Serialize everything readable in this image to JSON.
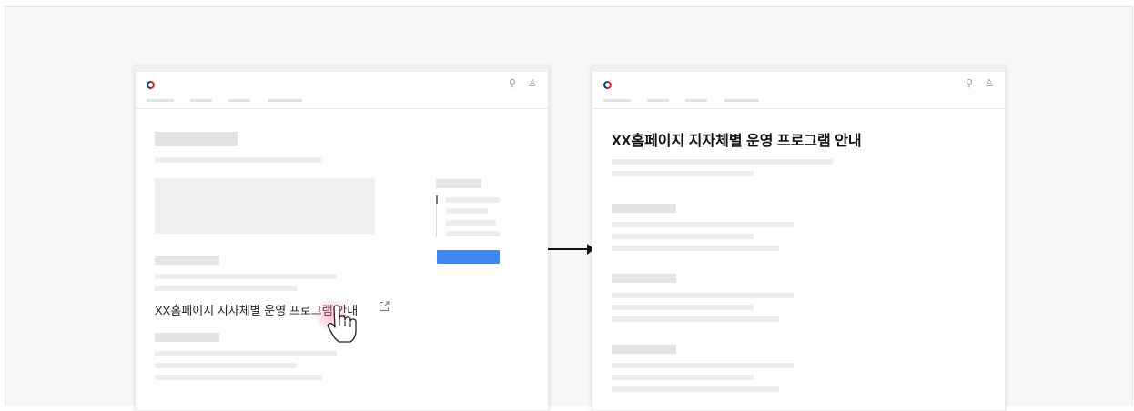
{
  "left_page": {
    "link_text": "XX홈페이지 지자체별 운영 프로그램 안내",
    "link_icon": "external-link-icon",
    "header_icons": [
      "search-icon",
      "user-icon"
    ]
  },
  "right_page": {
    "title": "XX홈페이지 지자체별 운영 프로그램 안내",
    "header_icons": [
      "search-icon",
      "user-icon"
    ]
  },
  "colors": {
    "accent_button": "#3d87f5",
    "arrow": "#111111",
    "hover_glow": "#ff8fb0"
  }
}
